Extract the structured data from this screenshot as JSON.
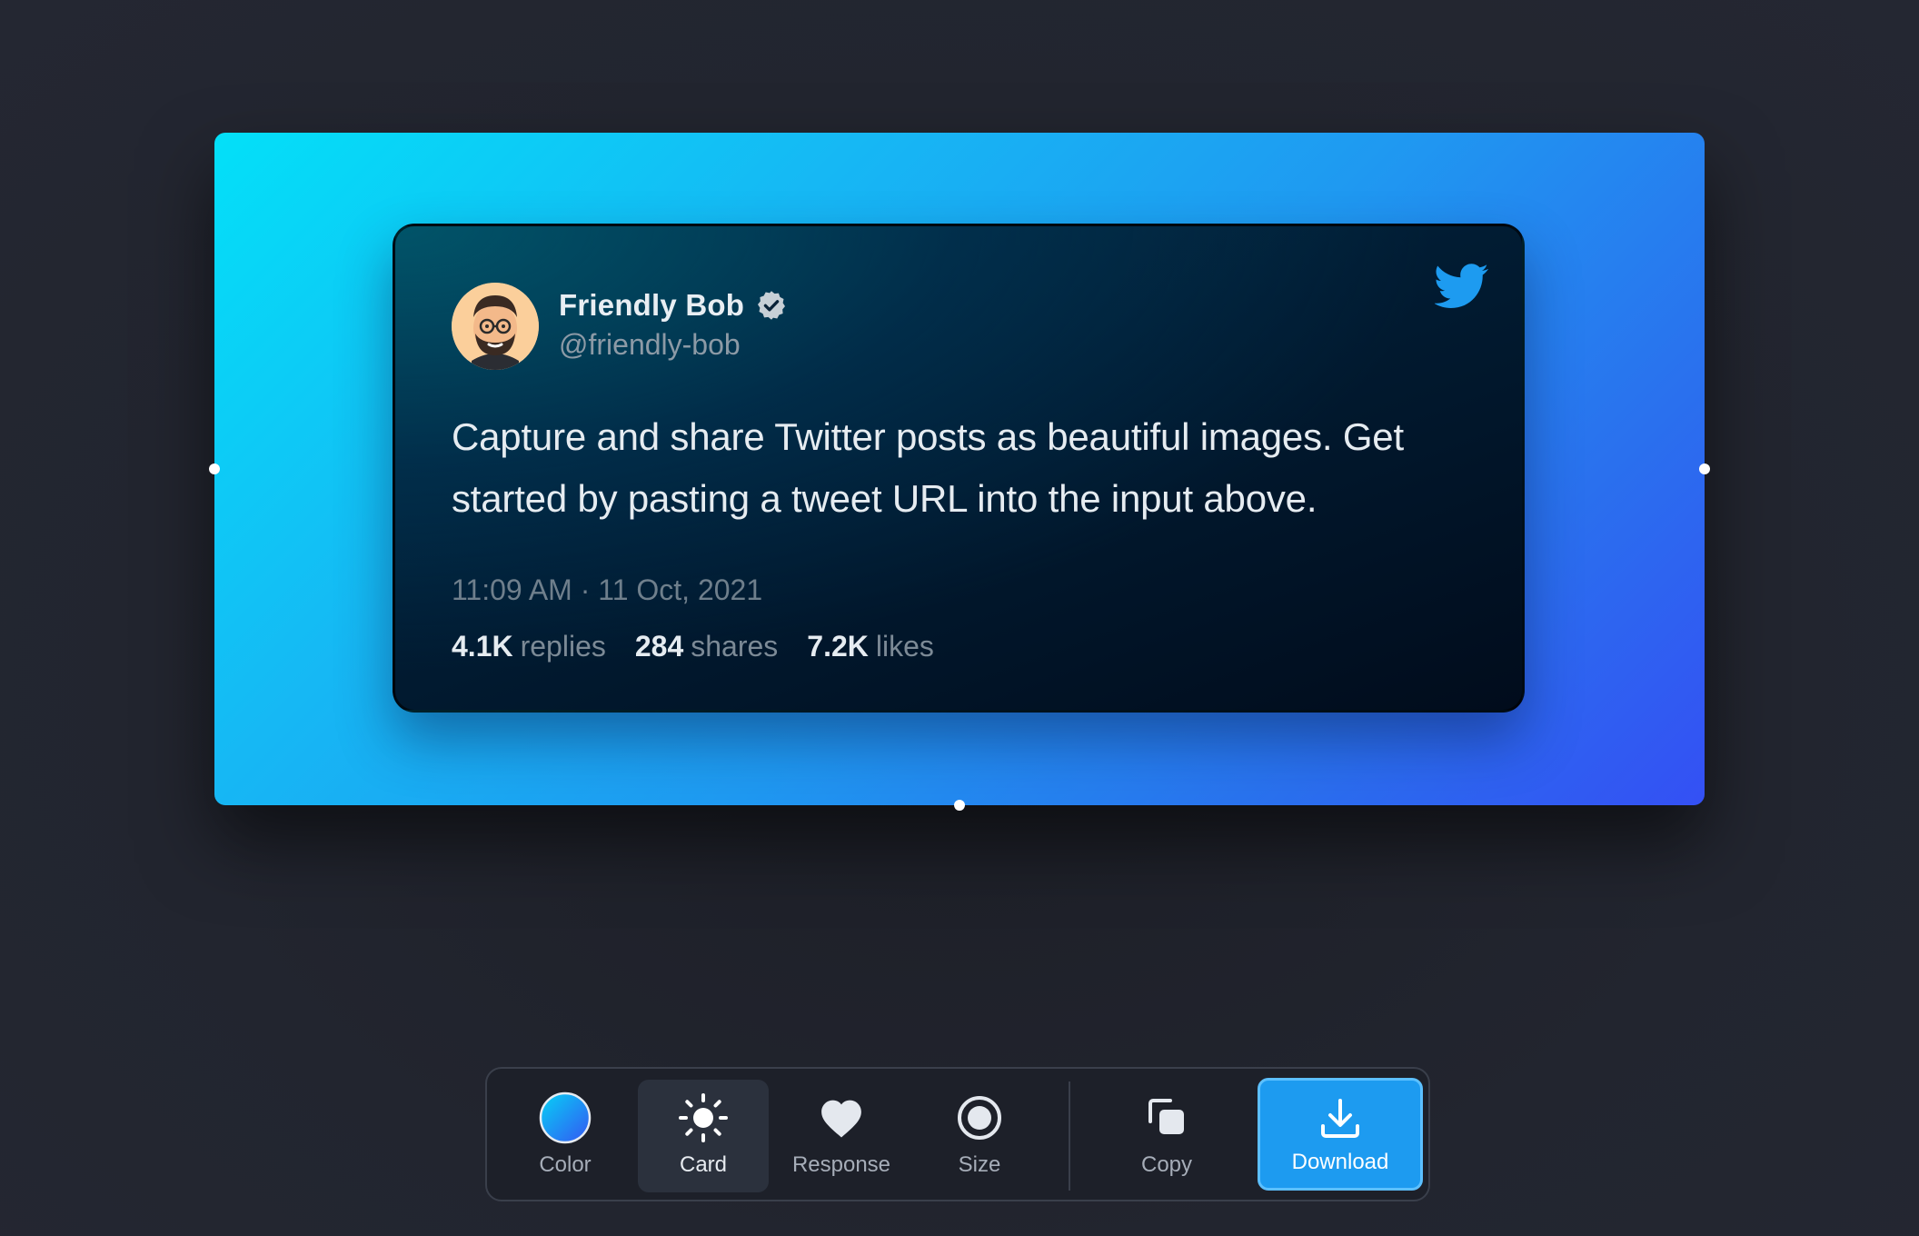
{
  "tweet": {
    "author_name": "Friendly Bob",
    "author_handle": "@friendly-bob",
    "verified": true,
    "text": "Capture and share Twitter posts as beautiful images. Get started by pasting a tweet URL into the input above.",
    "timestamp": "11:09 AM · 11 Oct, 2021",
    "stats": [
      {
        "value": "4.1K",
        "label": "replies"
      },
      {
        "value": "284",
        "label": "shares"
      },
      {
        "value": "7.2K",
        "label": "likes"
      }
    ]
  },
  "toolbar": {
    "color_label": "Color",
    "card_label": "Card",
    "response_label": "Response",
    "size_label": "Size",
    "copy_label": "Copy",
    "download_label": "Download"
  },
  "colors": {
    "page_background": "#22252f",
    "gradient_start": "#03e0f8",
    "gradient_end": "#3450f4",
    "twitter_blue": "#1d9bf0",
    "card_background": "#011c33"
  },
  "icons": {
    "avatar": "memoji-avatar",
    "verified": "verified-badge-icon",
    "brand": "twitter-bird-icon",
    "color": "color-swatch-icon",
    "card": "sun-icon",
    "response": "heart-icon",
    "size": "radio-circle-icon",
    "copy": "copy-icon",
    "download": "download-icon"
  }
}
